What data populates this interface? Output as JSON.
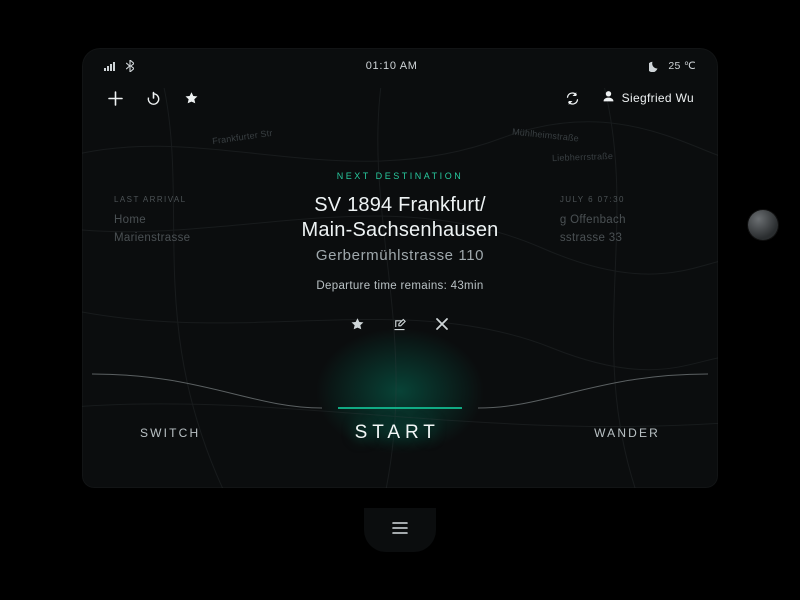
{
  "status": {
    "time": "01:10 AM",
    "temperature": "25 ℃"
  },
  "user": {
    "name": "Siegfried Wu"
  },
  "map": {
    "labels": {
      "l1": "Frankfurter Str",
      "l2": "Liebherrstraße",
      "l3": "Mühlheimstraße"
    }
  },
  "left_card": {
    "tag": "LAST ARRIVAL",
    "line1": "Home",
    "line2": "Marienstrasse"
  },
  "right_card": {
    "tag": "JULY 6  07:30",
    "line1": "g Offenbach",
    "line2": "sstrasse 33"
  },
  "destination": {
    "tag": "NEXT  DESTINATION",
    "title_l1": "SV 1894 Frankfurt/",
    "title_l2": "Main-Sachsenhausen",
    "subtitle": "Gerbermühlstrasse 110",
    "departure": "Departure time remains: 43min"
  },
  "actions": {
    "switch": "SWITCH",
    "start": "START",
    "wander": "WANDER"
  }
}
